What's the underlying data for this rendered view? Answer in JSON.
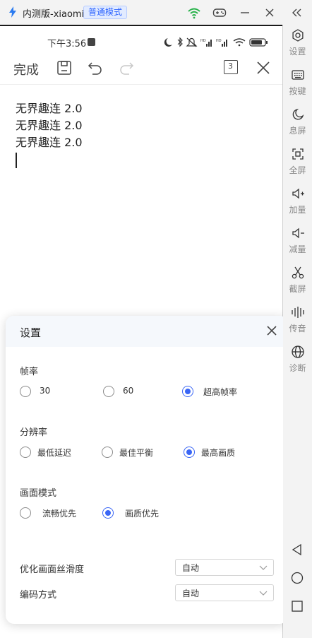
{
  "window": {
    "title": "内测版-xiaomi",
    "mode_badge": "普通模式"
  },
  "phone": {
    "status_time": "下午3:56",
    "toolbar": {
      "done_label": "完成",
      "page_count": "3"
    },
    "editor_lines": [
      "无界趣连 2.0",
      "无界趣连 2.0",
      "无界趣连 2.0"
    ]
  },
  "settings": {
    "title": "设置",
    "frame_rate": {
      "title": "帧率",
      "options": [
        "30",
        "60",
        "超高帧率"
      ],
      "selected": "超高帧率"
    },
    "resolution": {
      "title": "分辨率",
      "options": [
        "最低延迟",
        "最佳平衡",
        "最高画质"
      ],
      "selected": "最高画质"
    },
    "picture_mode": {
      "title": "画面模式",
      "options": [
        "流畅优先",
        "画质优先"
      ],
      "selected": "画质优先"
    },
    "smoothness": {
      "label": "优化画面丝滑度",
      "value": "自动"
    },
    "encoding": {
      "label": "编码方式",
      "value": "自动"
    }
  },
  "sidebar": {
    "items": [
      "设置",
      "按键",
      "息屏",
      "全屏",
      "加量",
      "减量",
      "截屏",
      "传音",
      "诊断"
    ]
  },
  "colors": {
    "accent": "#3a66f5",
    "badge": "#2b63ff",
    "wifi": "#27b24a"
  }
}
